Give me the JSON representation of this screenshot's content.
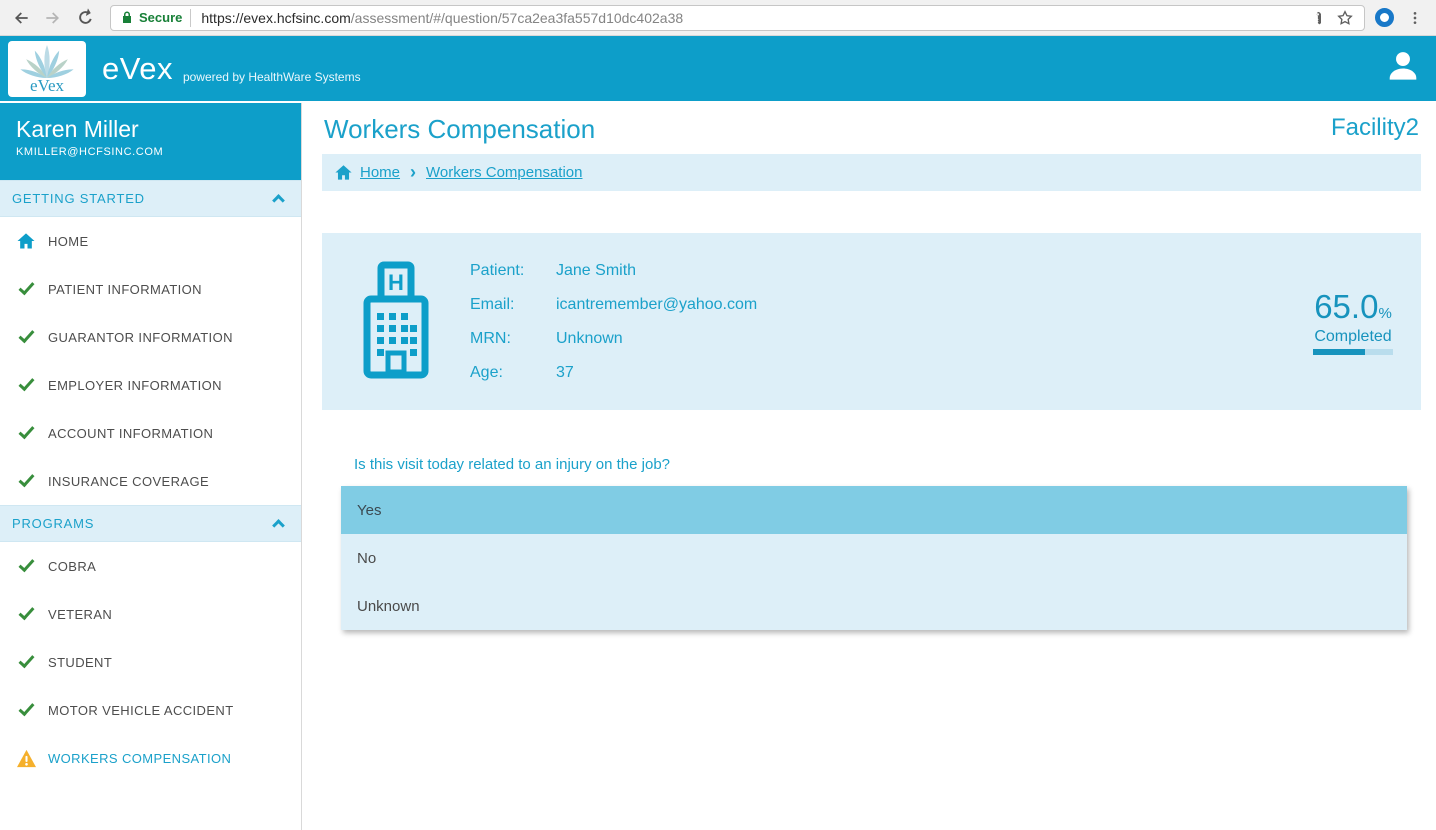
{
  "browser": {
    "secure_label": "Secure",
    "url_host": "https://evex.hcfsinc.com",
    "url_path": "/assessment/#/question/57ca2ea3fa557d10dc402a38"
  },
  "header": {
    "logo_text": "eVex",
    "app_name": "eVex",
    "powered_by": "powered by HealthWare Systems"
  },
  "sidebar": {
    "user": {
      "name": "Karen Miller",
      "email": "KMILLER@HCFSINC.COM"
    },
    "sections": [
      {
        "label": "GETTING STARTED",
        "items": [
          {
            "label": "HOME",
            "icon": "home"
          },
          {
            "label": "PATIENT INFORMATION",
            "icon": "check"
          },
          {
            "label": "GUARANTOR INFORMATION",
            "icon": "check"
          },
          {
            "label": "EMPLOYER INFORMATION",
            "icon": "check"
          },
          {
            "label": "ACCOUNT INFORMATION",
            "icon": "check"
          },
          {
            "label": "INSURANCE COVERAGE",
            "icon": "check"
          }
        ]
      },
      {
        "label": "PROGRAMS",
        "items": [
          {
            "label": "COBRA",
            "icon": "check"
          },
          {
            "label": "VETERAN",
            "icon": "check"
          },
          {
            "label": "STUDENT",
            "icon": "check"
          },
          {
            "label": "MOTOR VEHICLE ACCIDENT",
            "icon": "check"
          },
          {
            "label": "WORKERS COMPENSATION",
            "icon": "warning",
            "active": true
          }
        ]
      }
    ]
  },
  "main": {
    "title": "Workers Compensation",
    "facility": "Facility2",
    "breadcrumb": [
      {
        "label": "Home"
      },
      {
        "label": "Workers Compensation"
      }
    ],
    "patient_card": {
      "fields": [
        {
          "label": "Patient:",
          "value": "Jane Smith"
        },
        {
          "label": "Email:",
          "value": "icantremember@yahoo.com"
        },
        {
          "label": "MRN:",
          "value": "Unknown"
        },
        {
          "label": "Age:",
          "value": "37"
        }
      ],
      "progress": {
        "percent": "65.0",
        "percent_suffix": "%",
        "label": "Completed",
        "fraction": 0.65
      }
    },
    "question": {
      "text": "Is this visit today related to an injury on the job?",
      "options": [
        {
          "label": "Yes",
          "selected": true
        },
        {
          "label": "No",
          "selected": false
        },
        {
          "label": "Unknown",
          "selected": false
        }
      ]
    }
  },
  "colors": {
    "accent_teal": "#0d9ec9",
    "teal_text": "#1ba1ca",
    "light_blue": "#ddeff8",
    "selected_option": "#80cce4",
    "check_green": "#388e3c",
    "warning_yellow": "#f5b02c",
    "secure_green": "#188038"
  }
}
